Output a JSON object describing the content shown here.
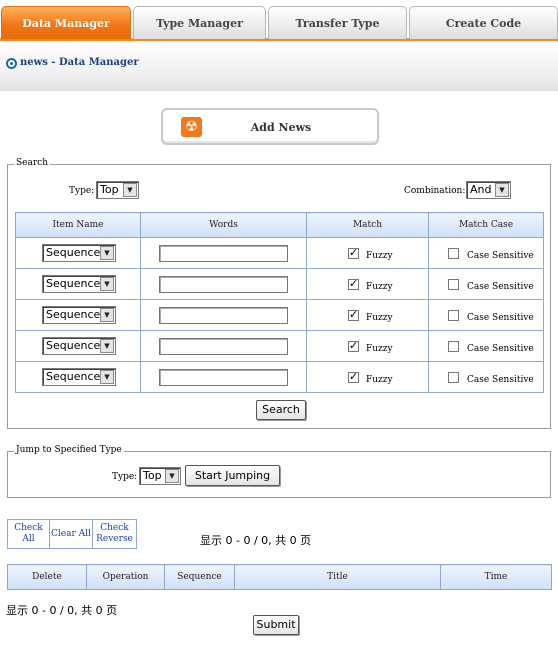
{
  "tabs": [
    {
      "label": "Data Manager",
      "active": true
    },
    {
      "label": "Type Manager",
      "active": false
    },
    {
      "label": "Transfer Type",
      "active": false
    },
    {
      "label": "Create Code",
      "active": false
    }
  ],
  "breadcrumb": "news - Data Manager",
  "add_news": "Add News",
  "search": {
    "legend": "Search",
    "type_label": "Type:",
    "type_value": "Top",
    "combination_label": "Combination:",
    "combination_value": "And",
    "headers": [
      "Item Name",
      "Words",
      "Match",
      "Match Case"
    ],
    "rows": [
      {
        "item": "Sequence",
        "words": "",
        "fuzzy": "Fuzzy",
        "case": "Case Sensitive",
        "fuzzy_checked": true,
        "case_checked": false
      },
      {
        "item": "Sequence",
        "words": "",
        "fuzzy": "Fuzzy",
        "case": "Case Sensitive",
        "fuzzy_checked": true,
        "case_checked": false
      },
      {
        "item": "Sequence",
        "words": "",
        "fuzzy": "Fuzzy",
        "case": "Case Sensitive",
        "fuzzy_checked": true,
        "case_checked": false
      },
      {
        "item": "Sequence",
        "words": "",
        "fuzzy": "Fuzzy",
        "case": "Case Sensitive",
        "fuzzy_checked": true,
        "case_checked": false
      },
      {
        "item": "Sequence",
        "words": "",
        "fuzzy": "Fuzzy",
        "case": "Case Sensitive",
        "fuzzy_checked": true,
        "case_checked": false
      }
    ],
    "button": "Search"
  },
  "jump": {
    "legend": "Jump to Specified Type",
    "type_label": "Type:",
    "type_value": "Top",
    "button": "Start Jumping"
  },
  "actions": {
    "check_all": "Check All",
    "clear_all": "Clear All",
    "check_reverse": "Check Reverse"
  },
  "pager_text": "显示 0 - 0 / 0, 共 0 页",
  "list_headers": [
    "Delete",
    "Operation",
    "Sequence",
    "Title",
    "Time"
  ],
  "submit": "Submit",
  "colors": {
    "accent": "#f07818",
    "link": "#1a40b0",
    "header_blue": "#cfe0f8"
  }
}
